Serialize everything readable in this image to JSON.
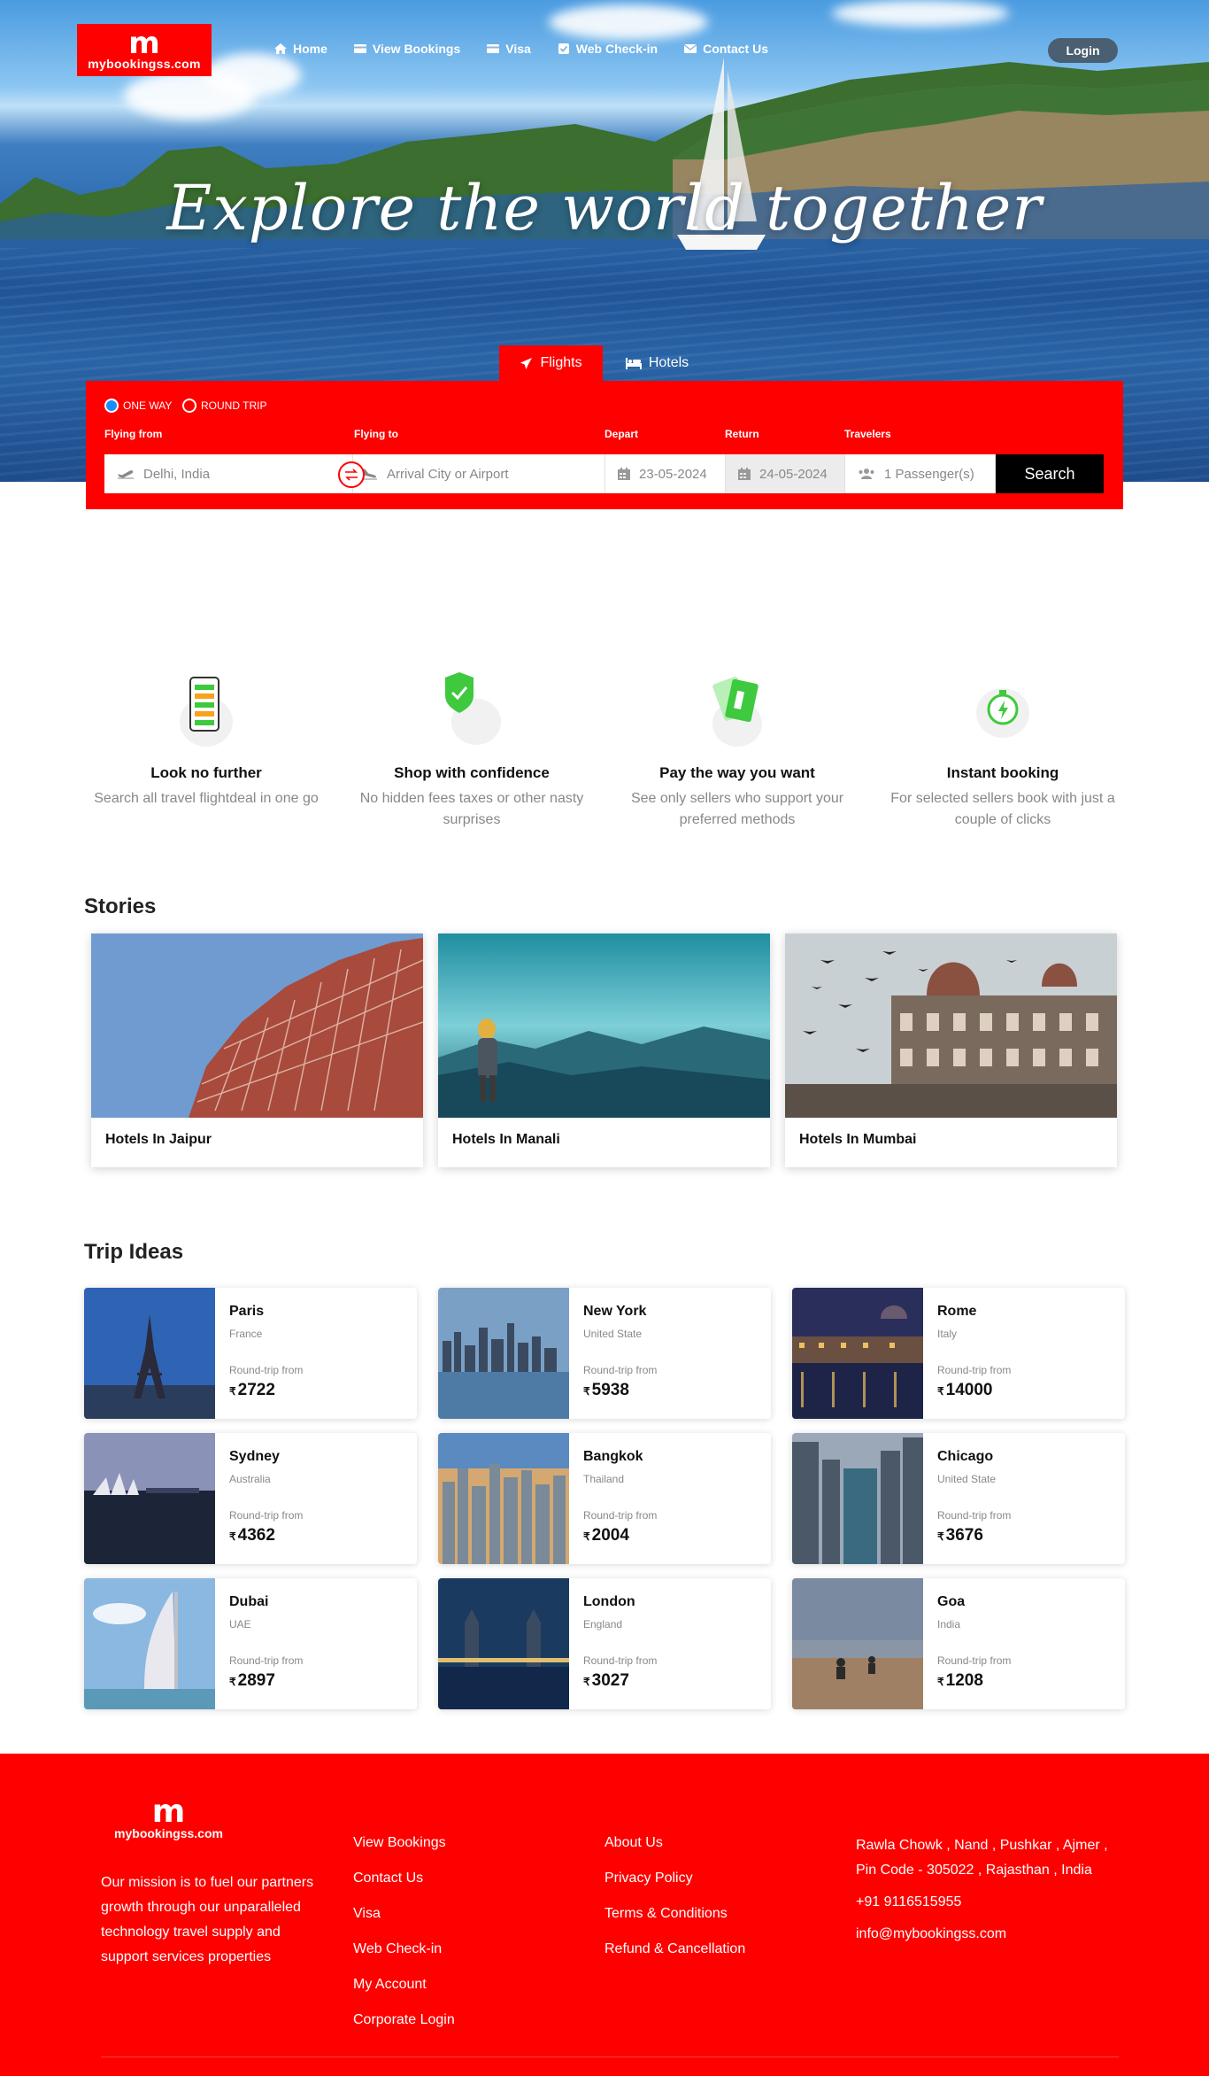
{
  "header": {
    "logo_mark": "m",
    "logo_brand": "mybookingss.com",
    "nav": [
      {
        "label": "Home",
        "icon": "home-icon"
      },
      {
        "label": "View Bookings",
        "icon": "card-icon"
      },
      {
        "label": "Visa",
        "icon": "card-icon"
      },
      {
        "label": "Web Check-in",
        "icon": "check-icon"
      },
      {
        "label": "Contact Us",
        "icon": "mail-icon"
      }
    ],
    "login": "Login"
  },
  "hero": {
    "headline": "Explore the world together"
  },
  "tabs": {
    "flights": "Flights",
    "hotels": "Hotels"
  },
  "search": {
    "one_way": "ONE WAY",
    "round_trip": "ROUND TRIP",
    "labels": {
      "from": "Flying from",
      "to": "Flying to",
      "depart": "Depart",
      "return": "Return",
      "travelers": "Travelers"
    },
    "from_placeholder": "Delhi, India",
    "to_placeholder": "Arrival City or Airport",
    "depart_value": "23-05-2024",
    "return_value": "24-05-2024",
    "travelers_value": "1 Passenger(s)",
    "button": "Search"
  },
  "features": [
    {
      "title": "Look no further",
      "text": "Search all travel flightdeal in one go"
    },
    {
      "title": "Shop with confidence",
      "text": "No hidden fees taxes or other nasty surprises"
    },
    {
      "title": "Pay the way you want",
      "text": "See only sellers who support your preferred methods"
    },
    {
      "title": "Instant booking",
      "text": "For selected sellers book with just a couple of clicks"
    }
  ],
  "stories": {
    "title": "Stories",
    "items": [
      {
        "caption": "Hotels In Jaipur"
      },
      {
        "caption": "Hotels In Manali"
      },
      {
        "caption": "Hotels In Mumbai"
      }
    ]
  },
  "trips": {
    "title": "Trip Ideas",
    "roundtrip_label": "Round-trip from",
    "currency": "₹",
    "items": [
      {
        "city": "Paris",
        "country": "France",
        "price": "2722"
      },
      {
        "city": "New York",
        "country": "United State",
        "price": "5938"
      },
      {
        "city": "Rome",
        "country": "Italy",
        "price": "14000"
      },
      {
        "city": "Sydney",
        "country": "Australia",
        "price": "4362"
      },
      {
        "city": "Bangkok",
        "country": "Thailand",
        "price": "2004"
      },
      {
        "city": "Chicago",
        "country": "United State",
        "price": "3676"
      },
      {
        "city": "Dubai",
        "country": "UAE",
        "price": "2897"
      },
      {
        "city": "London",
        "country": "England",
        "price": "3027"
      },
      {
        "city": "Goa",
        "country": "India",
        "price": "1208"
      }
    ]
  },
  "footer": {
    "logo_mark": "m",
    "logo_brand": "mybookingss.com",
    "mission": "Our mission is to fuel our partners growth through our unparalleled technology travel supply and support services properties",
    "col1": [
      "View Bookings",
      "Contact Us",
      "Visa",
      "Web Check-in",
      "My Account",
      "Corporate Login"
    ],
    "col2": [
      "About Us",
      "Privacy Policy",
      "Terms & Conditions",
      "Refund & Cancellation"
    ],
    "address": "Rawla Chowk , Nand , Pushkar , Ajmer , Pin Code - 305022 , Rajasthan , India",
    "phone": "+91 9116515955",
    "email": "info@mybookingss.com"
  },
  "colors": {
    "brand_red": "#ff0000",
    "search_button": "#000000",
    "login_button": "#4a5f72"
  }
}
